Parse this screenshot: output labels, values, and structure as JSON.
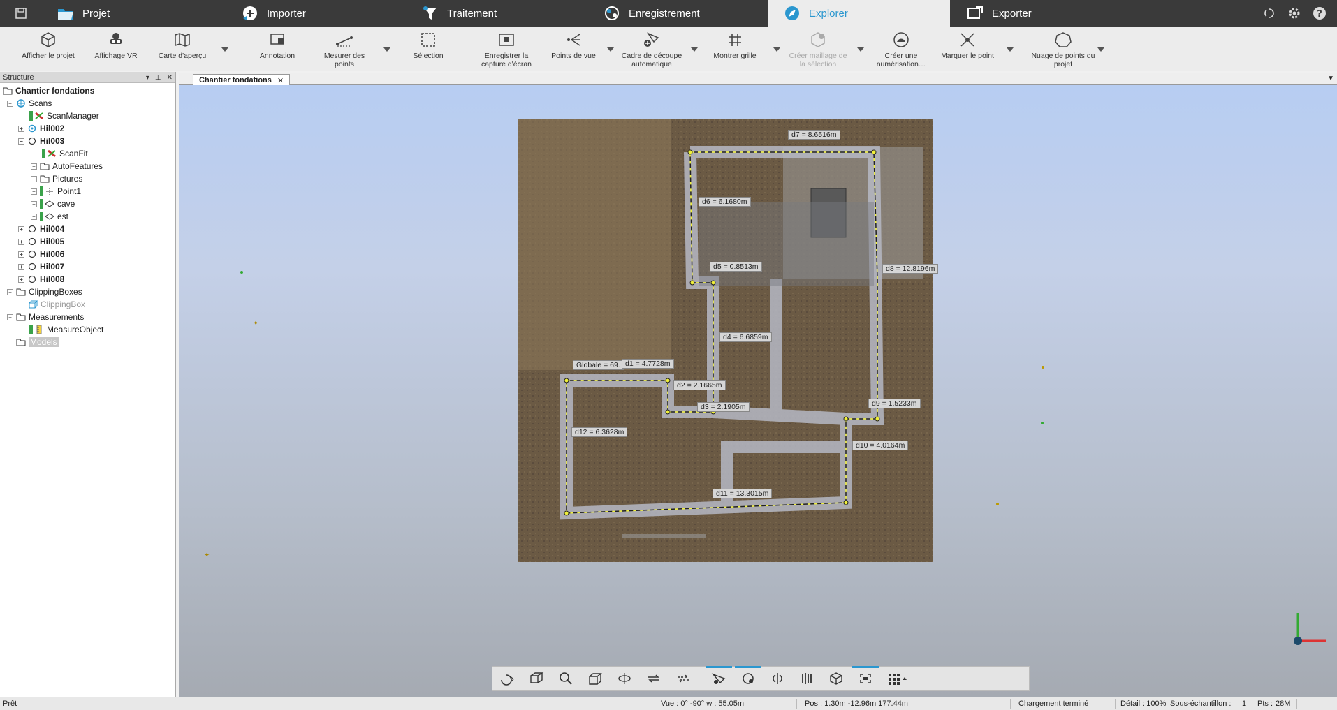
{
  "topbar": {
    "tabs": [
      {
        "label": "Projet",
        "icon": "folder-icon"
      },
      {
        "label": "Importer",
        "icon": "import-icon"
      },
      {
        "label": "Traitement",
        "icon": "funnel-icon"
      },
      {
        "label": "Enregistrement",
        "icon": "registration-icon"
      },
      {
        "label": "Explorer",
        "icon": "explorer-icon"
      },
      {
        "label": "Exporter",
        "icon": "export-icon"
      }
    ],
    "active_tab": "Explorer",
    "accent_color": "#2b97cf"
  },
  "ribbon": {
    "buttons": [
      {
        "label": "Afficher le projet",
        "icon": "cube-icon"
      },
      {
        "label": "Affichage VR",
        "icon": "vr-headset-icon"
      },
      {
        "label": "Carte d'aperçu",
        "icon": "map-icon"
      },
      {
        "label": "Annotation",
        "icon": "annotation-icon"
      },
      {
        "label": "Mesurer des points",
        "icon": "measure-icon"
      },
      {
        "label": "Sélection",
        "icon": "selection-icon"
      },
      {
        "label": "Enregistrer la capture d'écran",
        "icon": "screenshot-icon"
      },
      {
        "label": "Points de vue",
        "icon": "viewpoints-icon"
      },
      {
        "label": "Cadre de découpe automatique",
        "icon": "clipping-box-icon"
      },
      {
        "label": "Montrer grille",
        "icon": "grid-icon"
      },
      {
        "label": "Créer maillage de la sélection",
        "icon": "mesh-icon"
      },
      {
        "label": "Créer une numérisation…",
        "icon": "create-scan-icon"
      },
      {
        "label": "Marquer le point",
        "icon": "mark-point-icon"
      },
      {
        "label": "Nuage de points du projet",
        "icon": "point-cloud-icon"
      }
    ]
  },
  "panel": {
    "title": "Structure",
    "tree": [
      {
        "label": "Chantier fondations"
      },
      {
        "label": "Scans"
      },
      {
        "label": "ScanManager"
      },
      {
        "label": "Hil002"
      },
      {
        "label": "Hil003"
      },
      {
        "label": "ScanFit"
      },
      {
        "label": "AutoFeatures"
      },
      {
        "label": "Pictures"
      },
      {
        "label": "Point1"
      },
      {
        "label": "cave"
      },
      {
        "label": "est"
      },
      {
        "label": "Hil004"
      },
      {
        "label": "Hil005"
      },
      {
        "label": "Hil006"
      },
      {
        "label": "Hil007"
      },
      {
        "label": "Hil008"
      },
      {
        "label": "ClippingBoxes"
      },
      {
        "label": "ClippingBox"
      },
      {
        "label": "Measurements"
      },
      {
        "label": "MeasureObject"
      },
      {
        "label": "Models"
      }
    ]
  },
  "viewport": {
    "doc_tab": "Chantier fondations",
    "measurements": [
      {
        "label": "d7 = 8.6516m"
      },
      {
        "label": "d6 = 6.1680m"
      },
      {
        "label": "d5 = 0.8513m"
      },
      {
        "label": "d8 = 12.8196m"
      },
      {
        "label": "d4 = 6.6859m"
      },
      {
        "label": "Globale = 69."
      },
      {
        "label": "d1 = 4.7728m"
      },
      {
        "label": "d2 = 2.1665m"
      },
      {
        "label": "d3 = 2.1905m"
      },
      {
        "label": "d9 = 1.5233m"
      },
      {
        "label": "d12 = 6.3628m"
      },
      {
        "label": "d10 = 4.0164m"
      },
      {
        "label": "d11 = 13.3015m"
      }
    ]
  },
  "status": {
    "ready": "Prêt",
    "view": "Vue : 0° -90° w : 55.05m",
    "pos": "Pos : 1.30m -12.96m 177.44m",
    "loading": "Chargement terminé",
    "detail": "Détail : 100%",
    "subsample": "Sous-échantillon :",
    "subsample_val": "1",
    "pts": "Pts :",
    "pts_val": "28M"
  }
}
